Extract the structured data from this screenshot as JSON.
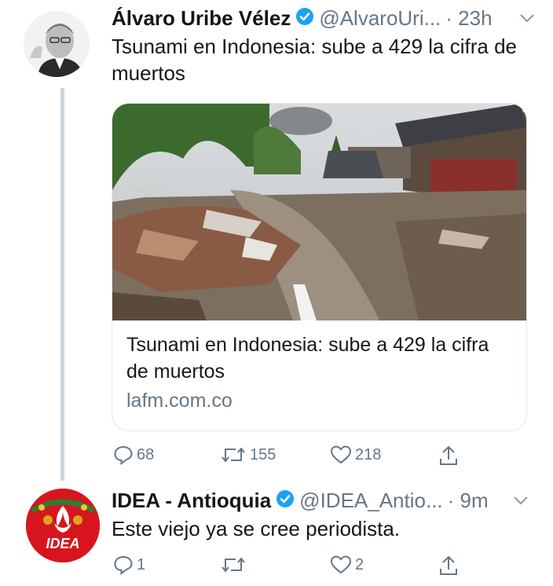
{
  "tweets": [
    {
      "display_name": "Álvaro Uribe Vélez",
      "handle": "@AlvaroUri...",
      "time": "· 23h",
      "text": "Tsunami en Indonesia: sube a 429 la cifra de muertos",
      "card": {
        "title": "Tsunami en Indonesia: sube a 429 la cifra de muertos",
        "domain": "lafm.com.co"
      },
      "actions": {
        "replies": "68",
        "retweets": "155",
        "likes": "218"
      }
    },
    {
      "display_name": "IDEA - Antioquia",
      "handle": "@IDEA_Antio...",
      "time": "· 9m",
      "text": "Este viejo ya se cree periodista.",
      "avatar_logo_text": "IDEA",
      "actions": {
        "replies": "1",
        "retweets": "",
        "likes": "2"
      }
    }
  ],
  "colors": {
    "verified": "#1da1f2",
    "muted": "#657786",
    "idea_red": "#d7151e"
  },
  "icons": [
    "verified-badge-icon",
    "chevron-down-icon",
    "reply-icon",
    "retweet-icon",
    "like-icon",
    "share-icon"
  ]
}
